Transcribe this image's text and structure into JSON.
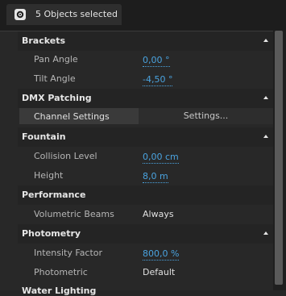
{
  "header": {
    "title": "5 Objects selected",
    "icon": "gear-icon"
  },
  "sections": {
    "brackets": {
      "title": "Brackets",
      "pan_angle_label": "Pan Angle",
      "pan_angle_value": "0,00 °",
      "tilt_angle_label": "Tilt Angle",
      "tilt_angle_value": "-4,50 °"
    },
    "dmx": {
      "title": "DMX Patching",
      "channel_settings_label": "Channel Settings",
      "settings_button": "Settings..."
    },
    "fountain": {
      "title": "Fountain",
      "collision_label": "Collision Level",
      "collision_value": "0,00 cm",
      "height_label": "Height",
      "height_value": "8,0 m"
    },
    "performance": {
      "title": "Performance",
      "volumetric_label": "Volumetric Beams",
      "volumetric_value": "Always"
    },
    "photometry": {
      "title": "Photometry",
      "intensity_label": "Intensity Factor",
      "intensity_value": "800,0 %",
      "photometric_label": "Photometric",
      "photometric_value": "Default"
    },
    "cut_off": {
      "title": "Water Lighting"
    }
  },
  "colors": {
    "accent": "#4aa3df",
    "background": "#282828",
    "header_background": "#242424"
  }
}
